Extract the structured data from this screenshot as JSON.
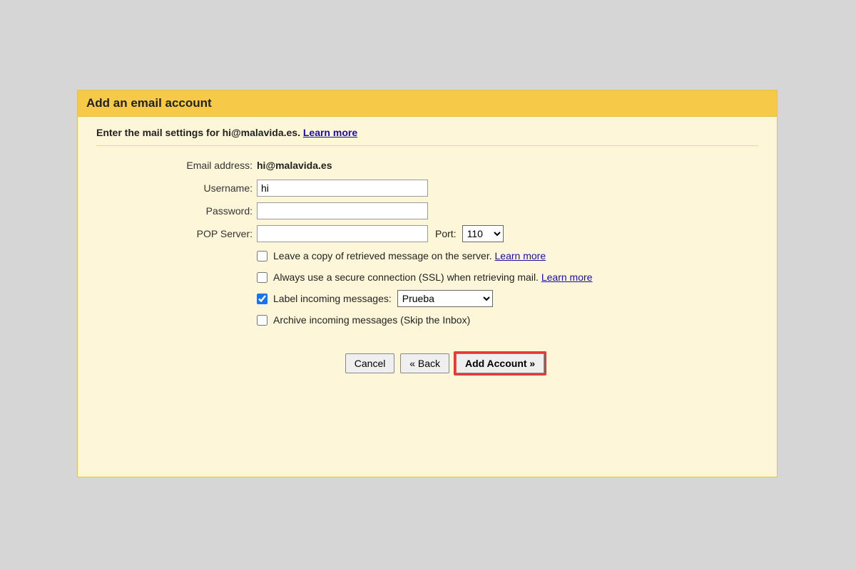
{
  "dialog": {
    "title": "Add an email account",
    "subheading_prefix": "Enter the mail settings for ",
    "subheading_email": "hi@malavida.es",
    "subheading_suffix": ". ",
    "learn_more": "Learn more"
  },
  "form": {
    "email_label": "Email address:",
    "email_value": "hi@malavida.es",
    "username_label": "Username:",
    "username_value": "hi",
    "password_label": "Password:",
    "password_value": "",
    "pop_label": "POP Server:",
    "pop_value": "",
    "port_label": "Port:",
    "port_value": "110"
  },
  "options": {
    "leave_copy": {
      "checked": false,
      "label": "Leave a copy of retrieved message on the server. ",
      "link": "Learn more"
    },
    "ssl": {
      "checked": false,
      "label": "Always use a secure connection (SSL) when retrieving mail. ",
      "link": "Learn more"
    },
    "label_msg": {
      "checked": true,
      "label": "Label incoming messages:",
      "select_value": "Prueba"
    },
    "archive": {
      "checked": false,
      "label": "Archive incoming messages (Skip the Inbox)"
    }
  },
  "buttons": {
    "cancel": "Cancel",
    "back": "« Back",
    "add": "Add Account »"
  }
}
